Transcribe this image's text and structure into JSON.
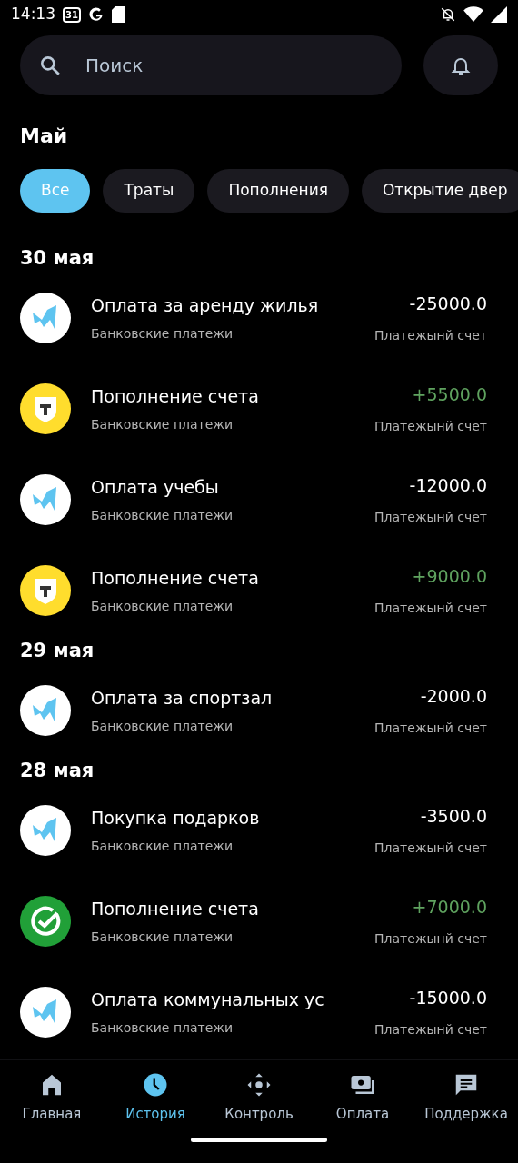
{
  "status_bar": {
    "time": "14:13",
    "calendar_day": "31"
  },
  "search": {
    "placeholder": "Поиск"
  },
  "month": "Май",
  "filters": [
    {
      "label": "Все",
      "selected": true
    },
    {
      "label": "Траты",
      "selected": false
    },
    {
      "label": "Пополнения",
      "selected": false
    },
    {
      "label": "Открытие двер",
      "selected": false
    }
  ],
  "groups": [
    {
      "date": "30 мая",
      "transactions": [
        {
          "kind": "m",
          "title": "Оплата за аренду жилья",
          "category": "Банковские платежи",
          "amount": "-25000.0",
          "income": false,
          "account": "Платежынй счет"
        },
        {
          "kind": "t",
          "title": "Пополнение счета",
          "category": "Банковские платежи",
          "amount": "+5500.0",
          "income": true,
          "account": "Платежынй счет"
        },
        {
          "kind": "m",
          "title": "Оплата учебы",
          "category": "Банковские платежи",
          "amount": "-12000.0",
          "income": false,
          "account": "Платежынй счет"
        },
        {
          "kind": "t",
          "title": "Пополнение счета",
          "category": "Банковские платежи",
          "amount": "+9000.0",
          "income": true,
          "account": "Платежынй счет"
        }
      ]
    },
    {
      "date": "29 мая",
      "transactions": [
        {
          "kind": "m",
          "title": "Оплата за спортзал",
          "category": "Банковские платежи",
          "amount": "-2000.0",
          "income": false,
          "account": "Платежынй счет"
        }
      ]
    },
    {
      "date": "28 мая",
      "transactions": [
        {
          "kind": "m",
          "title": "Покупка подарков",
          "category": "Банковские платежи",
          "amount": "-3500.0",
          "income": false,
          "account": "Платежынй счет"
        },
        {
          "kind": "check",
          "title": "Пополнение счета",
          "category": "Банковские платежи",
          "amount": "+7000.0",
          "income": true,
          "account": "Платежынй счет"
        },
        {
          "kind": "m",
          "title": "Оплата коммунальных ус",
          "category": "Банковские платежи",
          "amount": "-15000.0",
          "income": false,
          "account": "Платежынй счет"
        }
      ]
    }
  ],
  "bottom_nav": [
    {
      "kind": "home",
      "label": "Главная",
      "selected": false
    },
    {
      "kind": "clock",
      "label": "История",
      "selected": true
    },
    {
      "kind": "control",
      "label": "Контроль",
      "selected": false
    },
    {
      "kind": "money",
      "label": "Оплата",
      "selected": false
    },
    {
      "kind": "chat",
      "label": "Поддержка",
      "selected": false
    }
  ]
}
